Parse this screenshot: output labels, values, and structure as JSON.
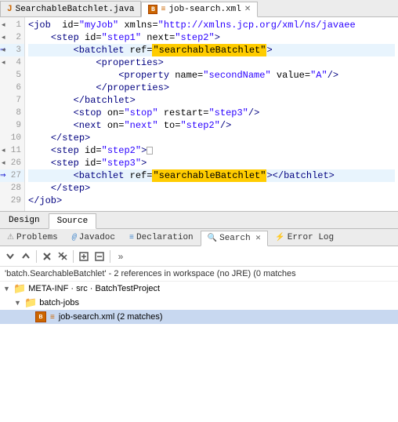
{
  "tabs": [
    {
      "id": "java-tab",
      "label": "SearchableBatchlet.java",
      "icon": "J",
      "active": false,
      "closeable": false
    },
    {
      "id": "xml-tab",
      "label": "job-search.xml",
      "icon": "X",
      "active": true,
      "closeable": true
    }
  ],
  "editor": {
    "lines": [
      {
        "num": "1",
        "fold": "◂",
        "indent": 0,
        "content": "<job  id=\"myJob\" xmlns=\"http://xmlns.jcp.org/xml/ns/javaee",
        "type": "tag"
      },
      {
        "num": "2",
        "fold": "◂",
        "indent": 1,
        "content": "    <step id=\"step1\" next=\"step2\">",
        "type": "tag"
      },
      {
        "num": "3",
        "fold": "◂",
        "indent": 2,
        "content": "        <batchlet ref=\"searchableBatchlet\">",
        "type": "tag-highlight",
        "arrow": true
      },
      {
        "num": "4",
        "fold": "◂",
        "indent": 3,
        "content": "            <properties>",
        "type": "tag"
      },
      {
        "num": "5",
        "fold": "",
        "indent": 4,
        "content": "                <property name=\"secondName\" value=\"A\"/>",
        "type": "tag"
      },
      {
        "num": "6",
        "fold": "",
        "indent": 3,
        "content": "            </properties>",
        "type": "tag"
      },
      {
        "num": "7",
        "fold": "",
        "indent": 2,
        "content": "        </batchlet>",
        "type": "tag"
      },
      {
        "num": "8",
        "fold": "",
        "indent": 2,
        "content": "        <stop on=\"stop\" restart=\"step3\"/>",
        "type": "tag"
      },
      {
        "num": "9",
        "fold": "",
        "indent": 2,
        "content": "        <next on=\"next\" to=\"step2\"/>",
        "type": "tag"
      },
      {
        "num": "10",
        "fold": "",
        "indent": 1,
        "content": "    </step>",
        "type": "tag"
      },
      {
        "num": "11",
        "fold": "◂",
        "indent": 1,
        "content": "    <step id=\"step2\">□",
        "type": "tag"
      },
      {
        "num": "26",
        "fold": "◂",
        "indent": 1,
        "content": "    <step id=\"step3\">",
        "type": "tag"
      },
      {
        "num": "27",
        "fold": "",
        "indent": 2,
        "content": "        <batchlet ref=\"searchableBatchlet\"></batchlet>",
        "type": "tag-highlight2",
        "arrow2": true
      },
      {
        "num": "28",
        "fold": "",
        "indent": 1,
        "content": "    </step>",
        "type": "tag"
      },
      {
        "num": "29",
        "fold": "",
        "indent": 0,
        "content": "</job>",
        "type": "tag"
      }
    ]
  },
  "view_tabs": [
    {
      "id": "design",
      "label": "Design",
      "active": false
    },
    {
      "id": "source",
      "label": "Source",
      "active": true
    }
  ],
  "bottom_tabs": [
    {
      "id": "problems",
      "label": "Problems",
      "icon": "⚠",
      "active": false
    },
    {
      "id": "javadoc",
      "label": "Javadoc",
      "icon": "@",
      "active": false
    },
    {
      "id": "declaration",
      "label": "Declaration",
      "icon": "≡",
      "active": false
    },
    {
      "id": "search",
      "label": "Search",
      "icon": "🔍",
      "active": true,
      "closeable": true
    },
    {
      "id": "errorlog",
      "label": "Error Log",
      "icon": "⚡",
      "active": false
    }
  ],
  "search": {
    "toolbar": {
      "buttons": [
        {
          "id": "down-arrow",
          "icon": "▼",
          "tooltip": "Next"
        },
        {
          "id": "up-arrow",
          "icon": "▲",
          "tooltip": "Previous"
        },
        {
          "id": "remove",
          "icon": "✕",
          "tooltip": "Remove"
        },
        {
          "id": "remove-all",
          "icon": "✕✕",
          "tooltip": "Remove All"
        },
        {
          "id": "expand-all",
          "icon": "⊞",
          "tooltip": "Expand All"
        },
        {
          "id": "collapse-all",
          "icon": "⊟",
          "tooltip": "Collapse All"
        },
        {
          "id": "more",
          "icon": "»",
          "tooltip": "More"
        }
      ]
    },
    "status": "'batch.SearchableBatchlet' - 2 references in workspace (no JRE) (0 matches",
    "tree": {
      "items": [
        {
          "id": "meta-inf",
          "label": "META-INF · src · BatchTestProject",
          "level": 0,
          "icon": "folder",
          "expanded": true,
          "chevron": "▼"
        },
        {
          "id": "batch-jobs",
          "label": "batch-jobs",
          "level": 1,
          "icon": "folder",
          "expanded": true,
          "chevron": "▼"
        },
        {
          "id": "job-search-xml",
          "label": "job-search.xml (2 matches)",
          "level": 2,
          "icon": "xml",
          "expanded": false,
          "chevron": "",
          "selected": true
        }
      ]
    }
  }
}
